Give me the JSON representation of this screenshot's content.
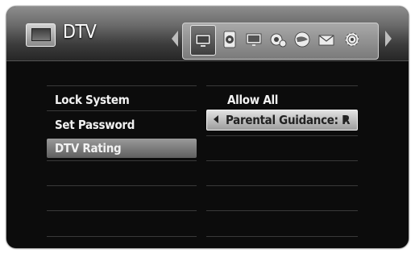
{
  "header": {
    "title": "DTV",
    "tabs": [
      {
        "icon": "tv-settings-icon"
      },
      {
        "icon": "speaker-icon"
      },
      {
        "icon": "monitor-icon"
      },
      {
        "icon": "gears-icon"
      },
      {
        "icon": "globe-icon"
      },
      {
        "icon": "envelope-icon"
      },
      {
        "icon": "gear-icon"
      }
    ]
  },
  "menu": {
    "items": [
      "Lock System",
      "Set Password",
      "DTV Rating"
    ],
    "selected": "DTV Rating"
  },
  "values": {
    "lock_system": "Allow All",
    "dtv_rating": "Parental Guidance: R"
  }
}
